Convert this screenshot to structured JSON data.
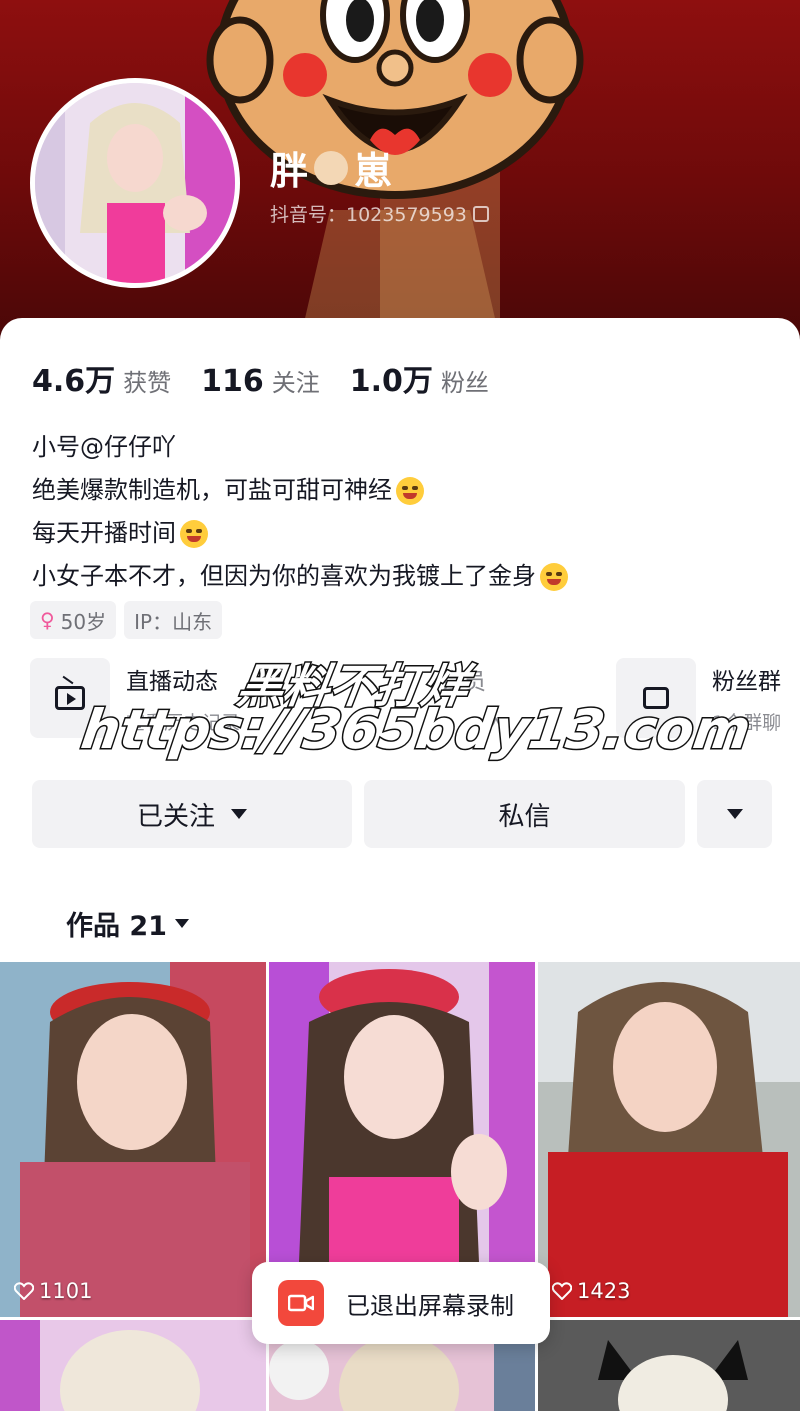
{
  "profile": {
    "nickname_left": "胖",
    "nickname_right": "崽",
    "douyin_id": "抖音号：1023579593"
  },
  "stats": [
    {
      "num": "4.6万",
      "label": "获赞"
    },
    {
      "num": "116",
      "label": "关注"
    },
    {
      "num": "1.0万",
      "label": "粉丝"
    }
  ],
  "bio": {
    "line1": "小号@仔仔吖",
    "line2": "绝美爆款制造机，可盐可甜可神经",
    "line3": "每天开播时间",
    "line4": "小女子本不才，但因为你的喜欢为我镀上了金身"
  },
  "tags": {
    "age": "50岁",
    "ip": "IP：山东"
  },
  "shortcuts": {
    "live_title": "直播动态",
    "live_sub": "查看历史记录",
    "member_title": "会员",
    "member_sub": "入",
    "fans_title": "粉丝群",
    "fans_sub": "1个群聊"
  },
  "watermark": {
    "line1": "黑料不打烊",
    "line2": "https://365bdy13.com"
  },
  "actions": {
    "follow_label": "已关注",
    "message_label": "私信"
  },
  "works": {
    "tab_label": "作品 21"
  },
  "grid": [
    {
      "likes": "1101"
    },
    {
      "likes": ""
    },
    {
      "likes": "1423"
    }
  ],
  "toast": {
    "text": "已退出屏幕录制"
  },
  "colors": {
    "banner": "#8e0f0f",
    "accent_pink": "#f0599b",
    "record_red": "#f2483c"
  }
}
